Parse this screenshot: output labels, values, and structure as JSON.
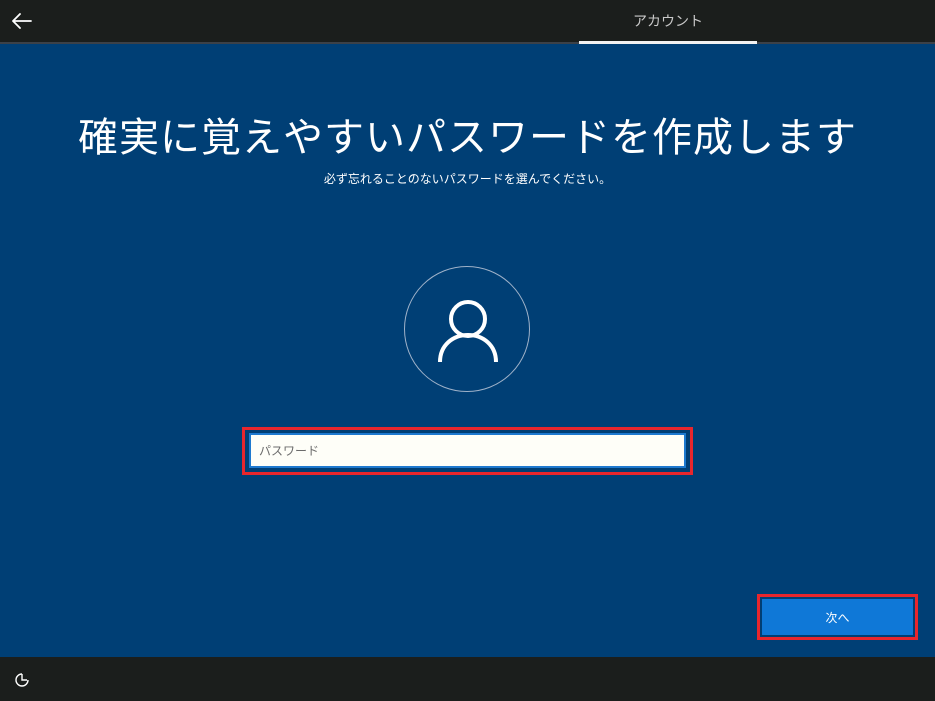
{
  "header": {
    "back_icon": "back-arrow-icon",
    "active_tab": "アカウント"
  },
  "main": {
    "title": "確実に覚えやすいパスワードを作成します",
    "subtitle": "必ず忘れることのないパスワードを選んでください。",
    "avatar_icon": "user-icon",
    "password_placeholder": "パスワード",
    "password_value": "",
    "next_label": "次へ"
  },
  "footer": {
    "accessibility_icon": "ease-of-access-icon"
  },
  "colors": {
    "background": "#003f75",
    "bar": "#1b1e1c",
    "button": "#0f78d7",
    "highlight": "#e8262d",
    "field_border": "#1e79cf"
  }
}
